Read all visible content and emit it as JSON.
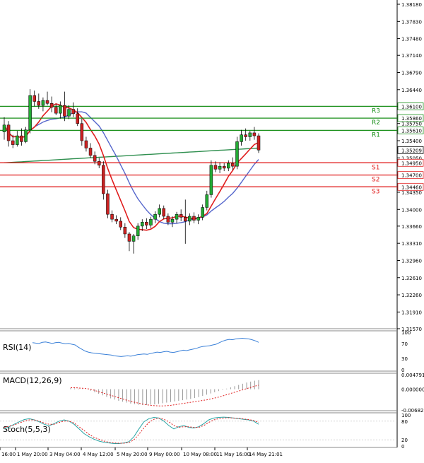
{
  "chart_data": [
    {
      "type": "candlestick",
      "panel": "price",
      "y_ticks": [
        "1.38180",
        "1.37830",
        "1.37480",
        "1.37140",
        "1.36790",
        "1.36440",
        "1.36100",
        "1.35750",
        "1.35400",
        "1.35050",
        "1.34700",
        "1.34350",
        "1.34000",
        "1.33660",
        "1.33310",
        "1.32960",
        "1.32610",
        "1.32260",
        "1.31910",
        "1.31570"
      ],
      "ylim": [
        1.3157,
        1.3818
      ],
      "x_ticks": [
        "16:00",
        "1 May 20:00",
        "3 May 04:00",
        "4 May 12:00",
        "5 May 20:00",
        "9 May 00:00",
        "10 May 08:00",
        "11 May 16:00",
        "14 May 21:01"
      ],
      "levels": [
        {
          "name": "R3",
          "value": 1.361,
          "label": "1.36100",
          "color": "#1a8f1a"
        },
        {
          "name": "R2",
          "value": 1.3586,
          "label": "1.35860",
          "color": "#1a8f1a"
        },
        {
          "name": "R1",
          "value": 1.3561,
          "label": "1.35610",
          "color": "#1a8f1a"
        },
        {
          "name": "S1",
          "value": 1.3495,
          "label": "1.34950",
          "color": "#e01e1e"
        },
        {
          "name": "S2",
          "value": 1.347,
          "label": "1.34700",
          "color": "#e01e1e"
        },
        {
          "name": "S3",
          "value": 1.3446,
          "label": "1.34460",
          "color": "#e01e1e"
        }
      ],
      "current_price": {
        "value": 1.35209,
        "label": "1.35209"
      },
      "candles": [
        [
          1.3558,
          1.3588,
          1.3542,
          1.3572
        ],
        [
          1.3572,
          1.358,
          1.3528,
          1.354
        ],
        [
          1.354,
          1.3552,
          1.3525,
          1.3532
        ],
        [
          1.3532,
          1.356,
          1.3528,
          1.355
        ],
        [
          1.355,
          1.3565,
          1.353,
          1.3538
        ],
        [
          1.3538,
          1.3568,
          1.3535,
          1.3562
        ],
        [
          1.3562,
          1.3645,
          1.3555,
          1.3632
        ],
        [
          1.3632,
          1.3642,
          1.361,
          1.362
        ],
        [
          1.362,
          1.3636,
          1.3605,
          1.3612
        ],
        [
          1.3612,
          1.3628,
          1.36,
          1.3622
        ],
        [
          1.3622,
          1.364,
          1.3612,
          1.3616
        ],
        [
          1.3616,
          1.363,
          1.3598,
          1.3608
        ],
        [
          1.3608,
          1.3615,
          1.3592,
          1.3596
        ],
        [
          1.3596,
          1.362,
          1.3585,
          1.3612
        ],
        [
          1.3612,
          1.364,
          1.358,
          1.359
        ],
        [
          1.359,
          1.3612,
          1.3584,
          1.3604
        ],
        [
          1.3604,
          1.3618,
          1.3588,
          1.3595
        ],
        [
          1.3595,
          1.3606,
          1.357,
          1.3575
        ],
        [
          1.3575,
          1.3585,
          1.353,
          1.354
        ],
        [
          1.354,
          1.3548,
          1.3518,
          1.3525
        ],
        [
          1.3525,
          1.3535,
          1.3505,
          1.351
        ],
        [
          1.351,
          1.3518,
          1.3492,
          1.3498
        ],
        [
          1.3498,
          1.3505,
          1.3484,
          1.349
        ],
        [
          1.349,
          1.3498,
          1.342,
          1.3432
        ],
        [
          1.3432,
          1.344,
          1.3382,
          1.339
        ],
        [
          1.339,
          1.3398,
          1.3374,
          1.338
        ],
        [
          1.338,
          1.3388,
          1.337,
          1.3376
        ],
        [
          1.3376,
          1.3384,
          1.3358,
          1.3364
        ],
        [
          1.3364,
          1.3372,
          1.3342,
          1.335
        ],
        [
          1.335,
          1.3354,
          1.3315,
          1.3335
        ],
        [
          1.3335,
          1.335,
          1.331,
          1.3346
        ],
        [
          1.3346,
          1.3372,
          1.3338,
          1.3366
        ],
        [
          1.3366,
          1.338,
          1.3356,
          1.3374
        ],
        [
          1.3374,
          1.3382,
          1.336,
          1.3368
        ],
        [
          1.3368,
          1.3385,
          1.3362,
          1.338
        ],
        [
          1.338,
          1.3396,
          1.3372,
          1.339
        ],
        [
          1.339,
          1.341,
          1.3384,
          1.3402
        ],
        [
          1.3402,
          1.3408,
          1.338,
          1.3386
        ],
        [
          1.3386,
          1.3392,
          1.3368,
          1.3374
        ],
        [
          1.3374,
          1.3386,
          1.3364,
          1.338
        ],
        [
          1.338,
          1.3395,
          1.3372,
          1.339
        ],
        [
          1.339,
          1.34,
          1.3376,
          1.3384
        ],
        [
          1.3384,
          1.342,
          1.333,
          1.3376
        ],
        [
          1.3376,
          1.3392,
          1.3368,
          1.3386
        ],
        [
          1.3386,
          1.3394,
          1.3372,
          1.3378
        ],
        [
          1.3378,
          1.339,
          1.337,
          1.3384
        ],
        [
          1.3384,
          1.341,
          1.3378,
          1.3404
        ],
        [
          1.3404,
          1.3438,
          1.3398,
          1.343
        ],
        [
          1.343,
          1.35,
          1.3424,
          1.349
        ],
        [
          1.349,
          1.3498,
          1.3476,
          1.3482
        ],
        [
          1.3482,
          1.3496,
          1.3474,
          1.3488
        ],
        [
          1.3488,
          1.3494,
          1.3478,
          1.3484
        ],
        [
          1.3484,
          1.35,
          1.3478,
          1.3494
        ],
        [
          1.3494,
          1.3506,
          1.348,
          1.3488
        ],
        [
          1.3488,
          1.3548,
          1.3482,
          1.3538
        ],
        [
          1.3538,
          1.3562,
          1.353,
          1.3552
        ],
        [
          1.3552,
          1.3565,
          1.354,
          1.3548
        ],
        [
          1.3548,
          1.356,
          1.354,
          1.3556
        ],
        [
          1.3556,
          1.3568,
          1.3542,
          1.355
        ],
        [
          1.355,
          1.3555,
          1.3515,
          1.3521
        ]
      ]
    },
    {
      "type": "line",
      "panel": "rsi",
      "title": "RSI(14)",
      "y_ticks": [
        "100",
        "70",
        "30",
        "0"
      ],
      "ylim": [
        0,
        100
      ],
      "values": [
        72,
        71,
        70,
        73,
        74,
        72,
        70,
        72,
        73,
        71,
        69,
        70,
        68,
        66,
        60,
        55,
        50,
        47,
        45,
        44,
        43,
        42,
        41,
        40,
        39,
        37,
        36,
        35,
        36,
        37,
        36,
        38,
        40,
        41,
        42,
        41,
        43,
        45,
        47,
        46,
        48,
        49,
        47,
        46,
        48,
        50,
        52,
        51,
        53,
        55,
        57,
        60,
        62,
        63,
        64,
        66,
        68,
        72,
        76,
        79,
        81,
        80,
        82,
        83,
        84,
        83,
        82,
        80,
        77,
        73
      ]
    },
    {
      "type": "bar",
      "panel": "macd",
      "title": "MACD(12,26,9)",
      "y_ticks": [
        "0.004791",
        "0.000000",
        "-0.006827"
      ],
      "ylim": [
        -0.006827,
        0.004791
      ],
      "histogram": [
        0.0004,
        0.0003,
        0.0002,
        0.0001,
        0.0,
        -0.0005,
        -0.001,
        -0.0015,
        -0.002,
        -0.0025,
        -0.003,
        -0.0034,
        -0.0038,
        -0.0041,
        -0.0044,
        -0.0047,
        -0.0049,
        -0.0051,
        -0.0052,
        -0.0052,
        -0.0051,
        -0.005,
        -0.0048,
        -0.0046,
        -0.0044,
        -0.0042,
        -0.004,
        -0.0038,
        -0.0036,
        -0.0034,
        -0.0032,
        -0.0029,
        -0.0026,
        -0.0022,
        -0.0018,
        -0.0014,
        -0.001,
        -0.0006,
        -0.0002,
        0.0002,
        0.0006,
        0.001,
        0.0014,
        0.0018,
        0.0022,
        0.0025,
        0.0028,
        0.003
      ],
      "signal": [
        0.0005,
        0.0005,
        0.0004,
        0.0003,
        0.0002,
        0.0,
        -0.0004,
        -0.0008,
        -0.0012,
        -0.0016,
        -0.002,
        -0.0024,
        -0.0028,
        -0.0032,
        -0.0036,
        -0.004,
        -0.0043,
        -0.0046,
        -0.0049,
        -0.0051,
        -0.0053,
        -0.0054,
        -0.0055,
        -0.0055,
        -0.0054,
        -0.0053,
        -0.0051,
        -0.0049,
        -0.0047,
        -0.0045,
        -0.0043,
        -0.0041,
        -0.0039,
        -0.0037,
        -0.0035,
        -0.0032,
        -0.0029,
        -0.0026,
        -0.0022,
        -0.0018,
        -0.0014,
        -0.001,
        -0.0006,
        -0.0002,
        0.0002,
        0.0006,
        0.001,
        0.0013
      ]
    },
    {
      "type": "line",
      "panel": "stoch",
      "title": "Stoch(5,5,3)",
      "y_ticks": [
        "100",
        "80",
        "20",
        "0"
      ],
      "ylim": [
        0,
        100
      ],
      "main": [
        55,
        62,
        70,
        78,
        85,
        88,
        84,
        78,
        70,
        65,
        72,
        80,
        84,
        80,
        70,
        55,
        40,
        30,
        22,
        16,
        12,
        10,
        8,
        8,
        10,
        14,
        30,
        55,
        78,
        88,
        92,
        90,
        80,
        66,
        55,
        62,
        66,
        60,
        58,
        62,
        72,
        84,
        90,
        92,
        93,
        92,
        90,
        88,
        86,
        84,
        80,
        70
      ],
      "signal": [
        60,
        64,
        68,
        74,
        80,
        84,
        84,
        80,
        74,
        70,
        70,
        76,
        80,
        80,
        74,
        62,
        50,
        38,
        28,
        22,
        16,
        12,
        10,
        9,
        9,
        11,
        20,
        38,
        58,
        76,
        86,
        90,
        86,
        78,
        66,
        60,
        62,
        62,
        60,
        60,
        66,
        76,
        84,
        88,
        90,
        91,
        90,
        89,
        87,
        85,
        82,
        76
      ]
    }
  ]
}
